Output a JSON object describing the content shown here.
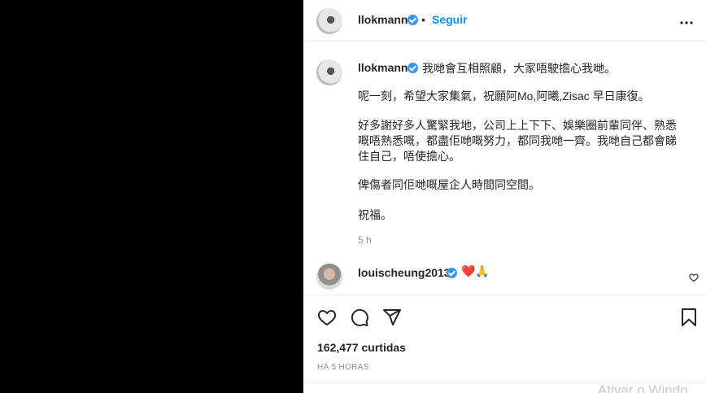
{
  "header": {
    "username": "llokmann",
    "separator": "•",
    "follow_label": "Seguir",
    "more_label": "•••"
  },
  "caption": {
    "username": "llokmann",
    "lines": [
      "我哋會互相照顧，大家唔駛擔心我哋。",
      "呢一刻，希望大家集氣，祝願阿Mo,阿曦,Zisac 早日康復。",
      "好多謝好多人驚緊我地，公司上上下下、娛樂圈前輩同伴、熟悉",
      "嘅唔熟悉嘅，都盡佢哋嘅努力，都同我哋一齊。我哋自己都會睇",
      "住自己，唔使擔心。",
      "俾傷者同佢哋嘅屋企人時間同空間。",
      "祝福。"
    ],
    "time": "5 h"
  },
  "comment": {
    "username": "louischeung2013",
    "emoji": "❤️🙏"
  },
  "likes_text": "162,477 curtidas",
  "posted_ago": "HÁ 5 HORAS",
  "watermark": "Ativar o Windo",
  "colors": {
    "accent": "#0095f6",
    "verified": "#3897f0",
    "text": "#262626",
    "muted": "#8e8e8e"
  },
  "icons": [
    "verified-icon",
    "more-icon",
    "heart-icon",
    "comment-icon",
    "share-icon",
    "bookmark-icon",
    "comment-like-icon"
  ]
}
